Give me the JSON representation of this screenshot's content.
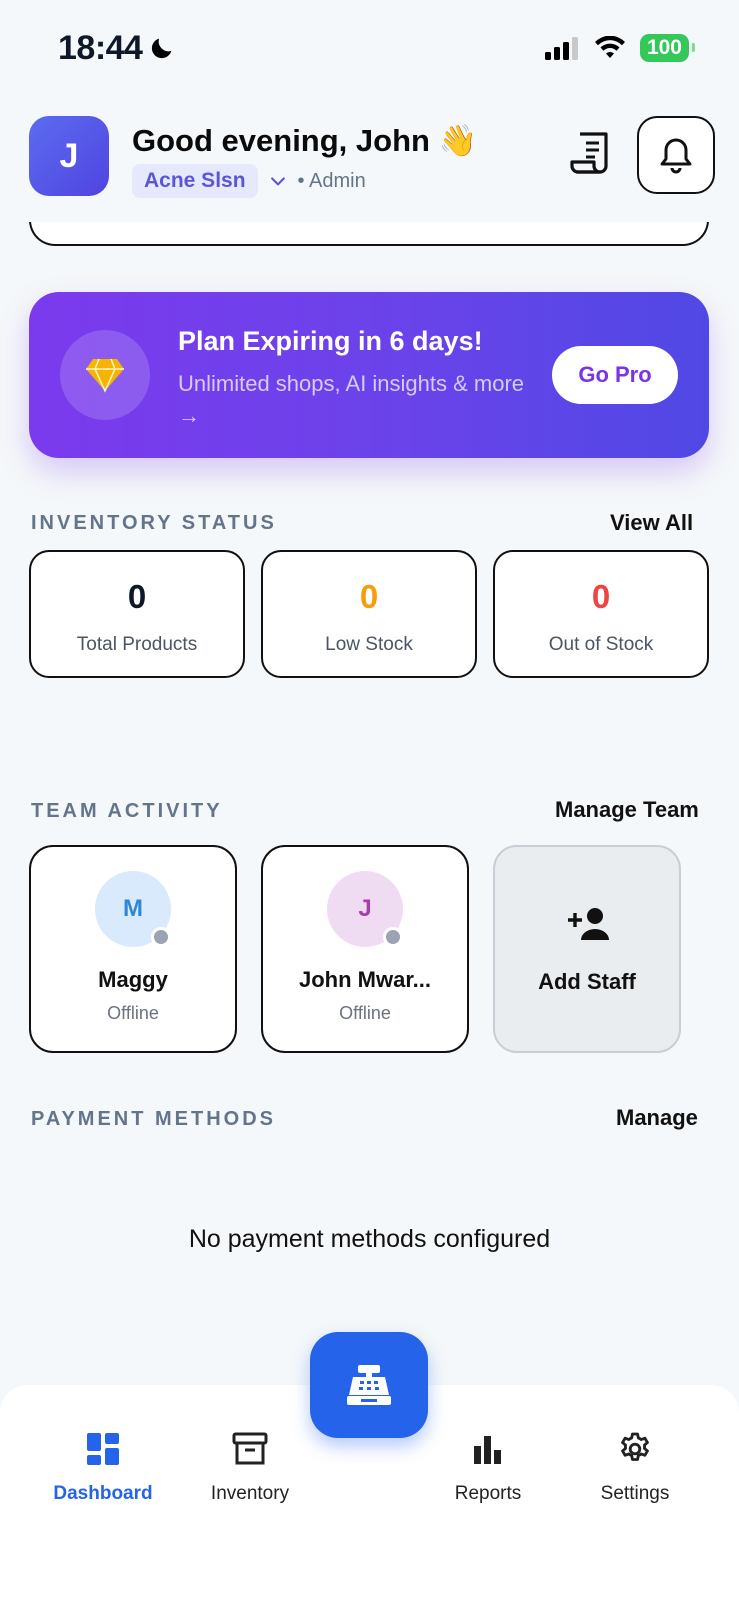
{
  "status_bar": {
    "time": "18:44",
    "battery": "100"
  },
  "header": {
    "avatar_initial": "J",
    "greeting": "Good evening, John 👋",
    "shop_name": "Acne Slsn",
    "role": "• Admin"
  },
  "promo": {
    "title": "Plan Expiring in 6 days!",
    "subtitle": "Unlimited shops, AI insights & more →",
    "button": "Go Pro"
  },
  "inventory": {
    "title": "INVENTORY STATUS",
    "link": "View All",
    "stats": [
      {
        "value": "0",
        "label": "Total Products",
        "color": "#0f172a"
      },
      {
        "value": "0",
        "label": "Low Stock",
        "color": "#f59e0b"
      },
      {
        "value": "0",
        "label": "Out of Stock",
        "color": "#ef4444"
      }
    ]
  },
  "team": {
    "title": "TEAM ACTIVITY",
    "link": "Manage Team",
    "members": [
      {
        "initial": "M",
        "name": "Maggy",
        "status": "Offline"
      },
      {
        "initial": "J",
        "name": "John Mwar...",
        "status": "Offline"
      }
    ],
    "add_label": "Add Staff"
  },
  "payments": {
    "title": "PAYMENT METHODS",
    "link": "Manage",
    "empty": "No payment methods configured"
  },
  "nav": {
    "dashboard": "Dashboard",
    "inventory": "Inventory",
    "reports": "Reports",
    "settings": "Settings"
  },
  "colors": {
    "accent": "#2563eb",
    "promo_start": "#7b3aed",
    "promo_end": "#5048e5"
  }
}
